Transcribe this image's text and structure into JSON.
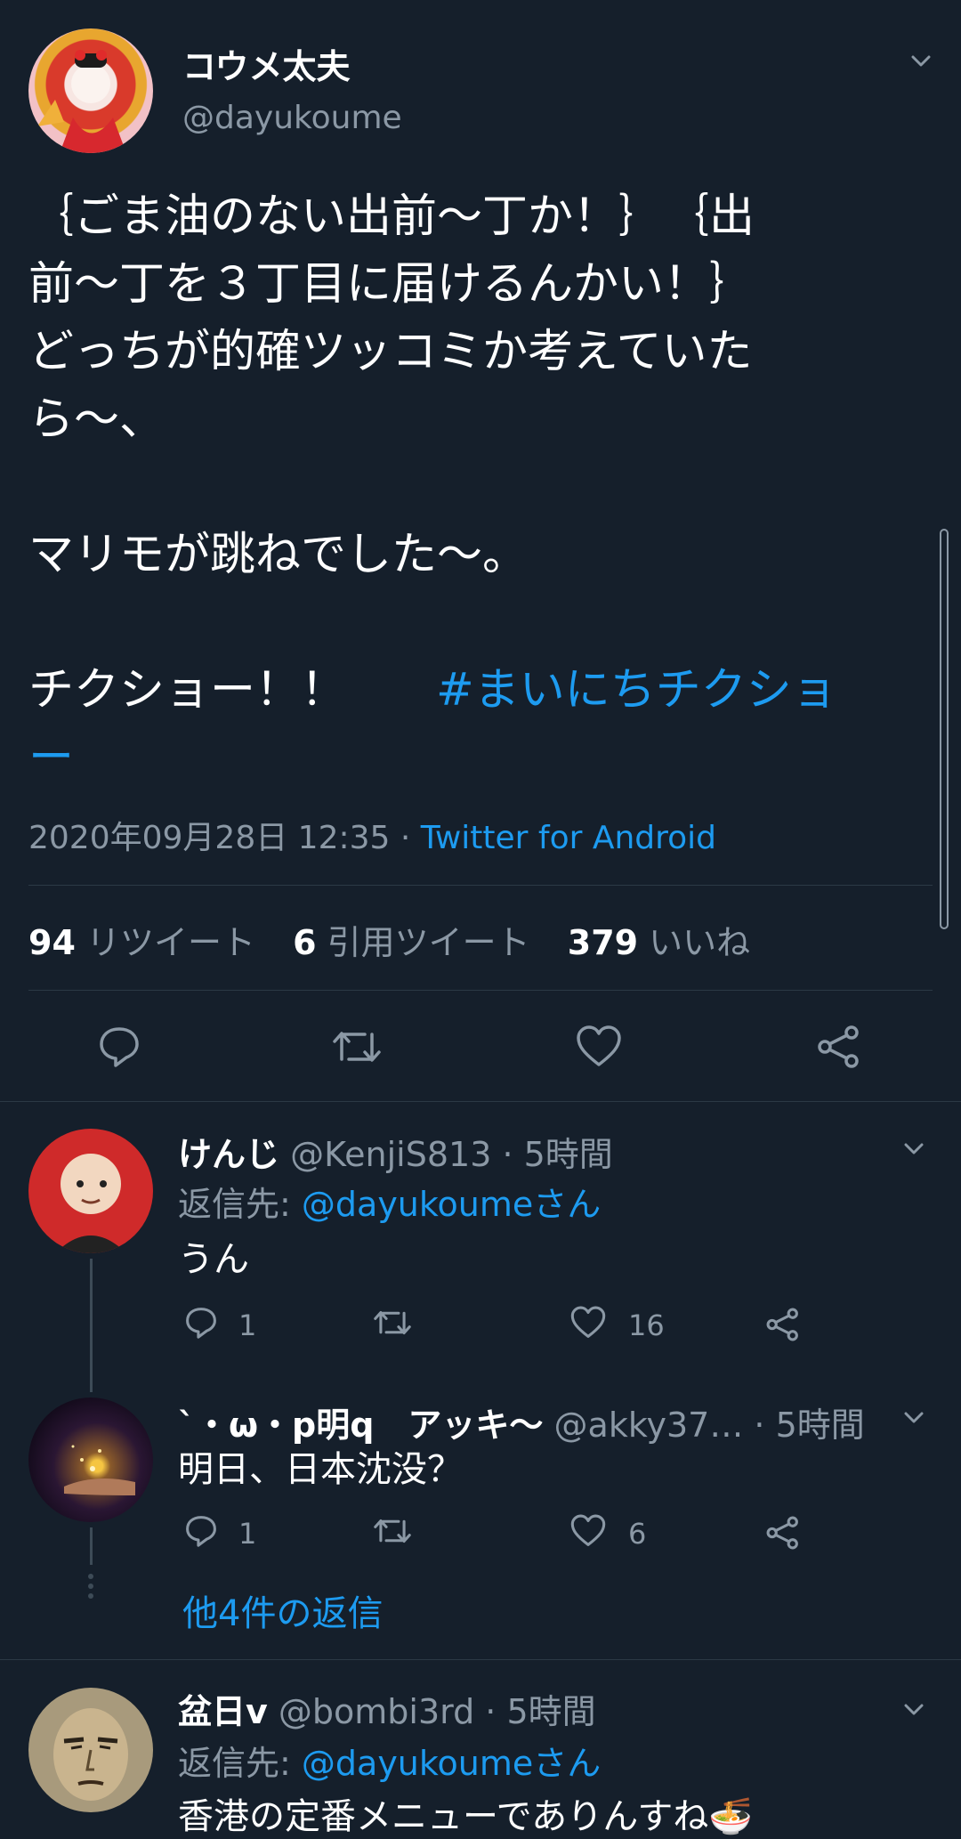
{
  "main_tweet": {
    "display_name": "コウメ太夫",
    "handle": "@dayukoume",
    "text_lines": [
      "｛ごま油のない出前〜丁か！｝　｛出",
      "前〜丁を３丁目に届けるんかい！｝",
      "どっちが的確ツッコミか考えていた",
      "ら〜、",
      "",
      "マリモが跳ねでした〜。",
      ""
    ],
    "last_line_text": "チクショー！！　",
    "hashtag_part1": "#まいにちチクショ",
    "hashtag_part2": "ー",
    "timestamp": "2020年09月28日 12:35",
    "separator": "·",
    "source": "Twitter for Android",
    "retweet_count": "94",
    "retweet_label": "リツイート",
    "quote_count": "6",
    "quote_label": "引用ツイート",
    "like_count": "379",
    "like_label": "いいね"
  },
  "replies": [
    {
      "display_name": "けんじ",
      "handle": "@KenjiS813",
      "time": "· 5時間",
      "reply_to_label": "返信先:",
      "reply_to_handle": "@dayukoumeさん",
      "text": "うん",
      "reply_count": "1",
      "like_count": "16"
    },
    {
      "display_name": "`・ω・p明q　アッキ〜",
      "handle": "@akky37…",
      "time": "· 5時間",
      "text": "明日、日本沈没？",
      "reply_count": "1",
      "like_count": "6"
    },
    {
      "display_name": "盆日v",
      "handle": "@bombi3rd",
      "time": "· 5時間",
      "reply_to_label": "返信先:",
      "reply_to_handle": "@dayukoumeさん",
      "text": "香港の定番メニューでありんすね🍜"
    }
  ],
  "more_replies": "他4件の返信",
  "colors": {
    "background": "#151f2b",
    "text": "#ffffff",
    "muted": "#8b98a5",
    "link": "#1d9bf0",
    "divider": "#2b3945"
  },
  "icons": [
    "chevron-down-icon",
    "reply-icon",
    "retweet-icon",
    "like-icon",
    "share-icon"
  ]
}
